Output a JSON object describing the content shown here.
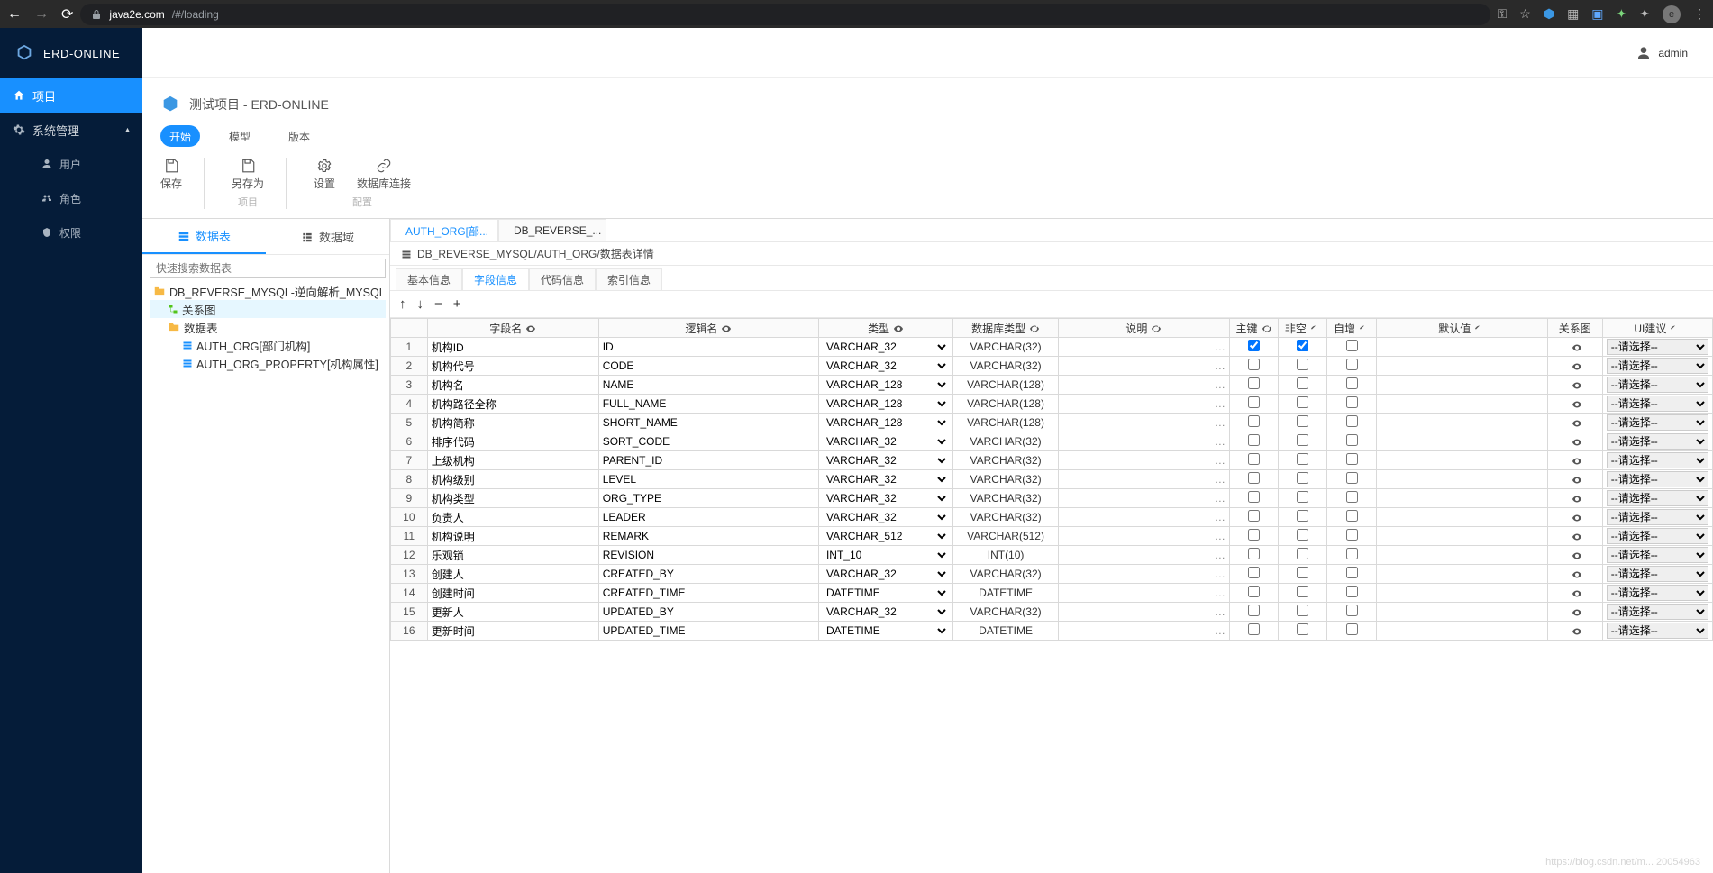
{
  "browser": {
    "url_host": "java2e.com",
    "url_path": "/#/loading"
  },
  "app": {
    "name": "ERD-ONLINE"
  },
  "user": {
    "name": "admin"
  },
  "sidebar": {
    "items": [
      {
        "label": "项目",
        "active": true,
        "icon": "home"
      },
      {
        "label": "系统管理",
        "active": false,
        "icon": "gear",
        "expandable": true,
        "expanded": true,
        "children": [
          {
            "label": "用户"
          },
          {
            "label": "角色"
          },
          {
            "label": "权限"
          }
        ]
      }
    ]
  },
  "ribbon": {
    "projectTitle": "测试项目 - ERD-ONLINE",
    "tabs": [
      {
        "label": "开始",
        "active": true
      },
      {
        "label": "模型",
        "active": false
      },
      {
        "label": "版本",
        "active": false
      }
    ],
    "actions": [
      {
        "buttons": [
          {
            "label": "保存",
            "icon": "save"
          }
        ],
        "group": ""
      },
      {
        "buttons": [
          {
            "label": "另存为",
            "icon": "save-as"
          }
        ],
        "group": "项目"
      },
      {
        "buttons": [
          {
            "label": "设置",
            "icon": "gear"
          },
          {
            "label": "数据库连接",
            "icon": "db-link"
          }
        ],
        "group": "配置"
      }
    ]
  },
  "treePanel": {
    "tabs": [
      {
        "label": "数据表",
        "active": true
      },
      {
        "label": "数据域",
        "active": false
      }
    ],
    "searchPlaceholder": "快速搜索数据表",
    "nodes": {
      "root": {
        "label": "DB_REVERSE_MYSQL-逆向解析_MYSQL"
      },
      "relDiagram": {
        "label": "关系图"
      },
      "tablesFolder": {
        "label": "数据表"
      },
      "items": [
        {
          "label": "AUTH_ORG[部门机构]"
        },
        {
          "label": "AUTH_ORG_PROPERTY[机构属性]"
        }
      ]
    }
  },
  "editor": {
    "docTabs": [
      {
        "label": "AUTH_ORG[部...",
        "active": true
      },
      {
        "label": "DB_REVERSE_...",
        "active": false
      }
    ],
    "breadcrumb": "DB_REVERSE_MYSQL/AUTH_ORG/数据表详情",
    "subTabs": [
      {
        "label": "基本信息",
        "active": false
      },
      {
        "label": "字段信息",
        "active": true
      },
      {
        "label": "代码信息",
        "active": false
      },
      {
        "label": "索引信息",
        "active": false
      }
    ],
    "columns": {
      "fieldName": "字段名",
      "logicName": "逻辑名",
      "type": "类型",
      "dbType": "数据库类型",
      "desc": "说明",
      "pk": "主键",
      "notnull": "非空",
      "autoinc": "自增",
      "default": "默认值",
      "rel": "关系图",
      "ui": "UI建议"
    },
    "uiSelectPlaceholder": "--请选择--",
    "rows": [
      {
        "n": 1,
        "field": "机构ID",
        "logic": "ID",
        "type": "VARCHAR_32",
        "dbType": "VARCHAR(32)",
        "pk": true,
        "nn": true
      },
      {
        "n": 2,
        "field": "机构代号",
        "logic": "CODE",
        "type": "VARCHAR_32",
        "dbType": "VARCHAR(32)",
        "pk": false,
        "nn": false
      },
      {
        "n": 3,
        "field": "机构名",
        "logic": "NAME",
        "type": "VARCHAR_128",
        "dbType": "VARCHAR(128)",
        "pk": false,
        "nn": false
      },
      {
        "n": 4,
        "field": "机构路径全称",
        "logic": "FULL_NAME",
        "type": "VARCHAR_128",
        "dbType": "VARCHAR(128)",
        "pk": false,
        "nn": false
      },
      {
        "n": 5,
        "field": "机构简称",
        "logic": "SHORT_NAME",
        "type": "VARCHAR_128",
        "dbType": "VARCHAR(128)",
        "pk": false,
        "nn": false
      },
      {
        "n": 6,
        "field": "排序代码",
        "logic": "SORT_CODE",
        "type": "VARCHAR_32",
        "dbType": "VARCHAR(32)",
        "pk": false,
        "nn": false
      },
      {
        "n": 7,
        "field": "上级机构",
        "logic": "PARENT_ID",
        "type": "VARCHAR_32",
        "dbType": "VARCHAR(32)",
        "pk": false,
        "nn": false
      },
      {
        "n": 8,
        "field": "机构级别",
        "logic": "LEVEL",
        "type": "VARCHAR_32",
        "dbType": "VARCHAR(32)",
        "pk": false,
        "nn": false
      },
      {
        "n": 9,
        "field": "机构类型",
        "logic": "ORG_TYPE",
        "type": "VARCHAR_32",
        "dbType": "VARCHAR(32)",
        "pk": false,
        "nn": false
      },
      {
        "n": 10,
        "field": "负责人",
        "logic": "LEADER",
        "type": "VARCHAR_32",
        "dbType": "VARCHAR(32)",
        "pk": false,
        "nn": false
      },
      {
        "n": 11,
        "field": "机构说明",
        "logic": "REMARK",
        "type": "VARCHAR_512",
        "dbType": "VARCHAR(512)",
        "pk": false,
        "nn": false
      },
      {
        "n": 12,
        "field": "乐观锁",
        "logic": "REVISION",
        "type": "INT_10",
        "dbType": "INT(10)",
        "pk": false,
        "nn": false
      },
      {
        "n": 13,
        "field": "创建人",
        "logic": "CREATED_BY",
        "type": "VARCHAR_32",
        "dbType": "VARCHAR(32)",
        "pk": false,
        "nn": false
      },
      {
        "n": 14,
        "field": "创建时间",
        "logic": "CREATED_TIME",
        "type": "DATETIME",
        "dbType": "DATETIME",
        "pk": false,
        "nn": false
      },
      {
        "n": 15,
        "field": "更新人",
        "logic": "UPDATED_BY",
        "type": "VARCHAR_32",
        "dbType": "VARCHAR(32)",
        "pk": false,
        "nn": false
      },
      {
        "n": 16,
        "field": "更新时间",
        "logic": "UPDATED_TIME",
        "type": "DATETIME",
        "dbType": "DATETIME",
        "pk": false,
        "nn": false
      }
    ]
  },
  "watermark": "https://blog.csdn.net/m... 20054963"
}
